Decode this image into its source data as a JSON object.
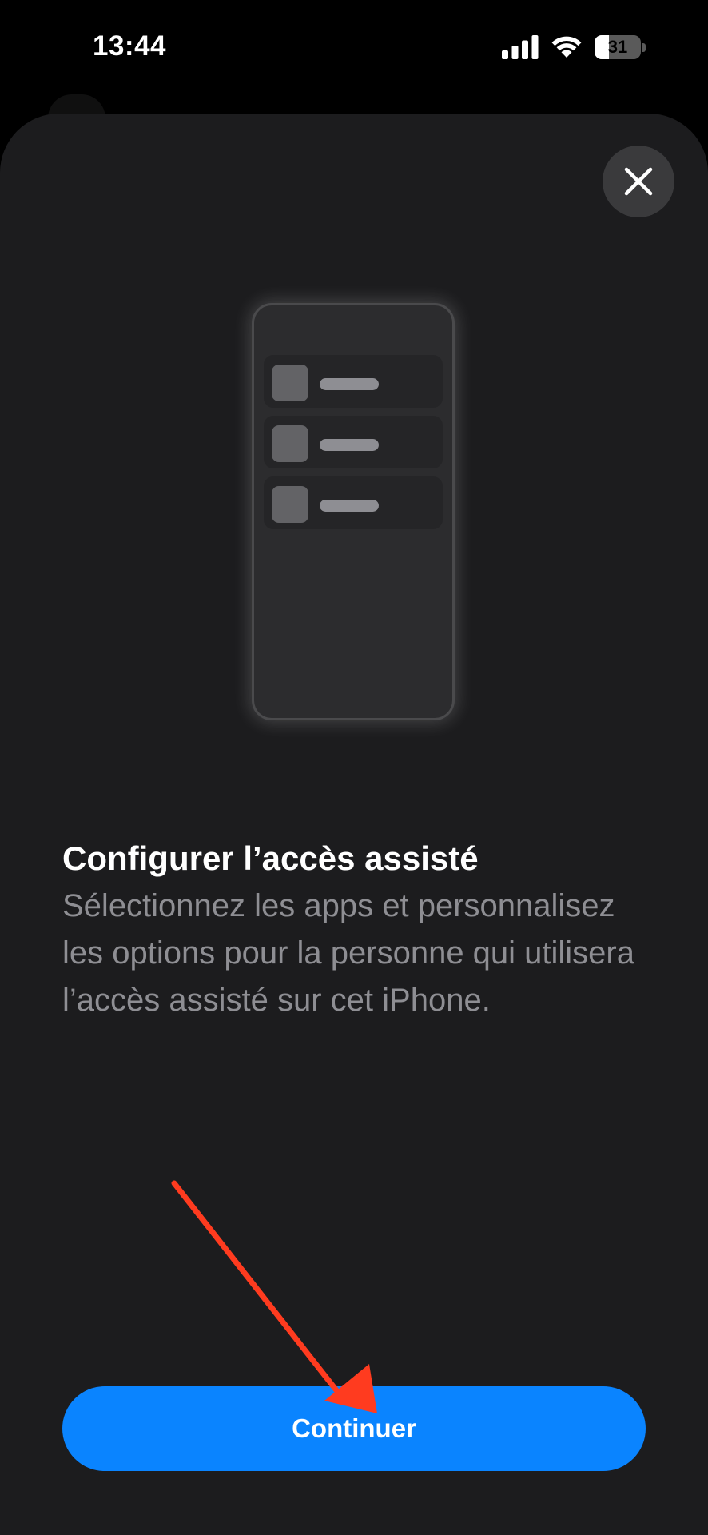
{
  "status_bar": {
    "time": "13:44",
    "battery_level": "31",
    "battery_fraction": 0.31,
    "signal_icon": "cellular-signal-icon",
    "wifi_icon": "wifi-icon",
    "battery_icon": "battery-icon"
  },
  "sheet": {
    "close_icon": "close-icon",
    "title": "Configurer l’accès assisté",
    "description": "Sélectionnez les apps et personnalisez les options pour la personne qui utilisera l’accès assisté sur cet iPhone.",
    "continue_label": "Continuer"
  },
  "illustration": {
    "rows": 3
  },
  "colors": {
    "background": "#000000",
    "sheet": "#1c1c1e",
    "accent": "#0a84ff",
    "secondary_text": "#8e8e93",
    "annotation_arrow": "#ff3b1f"
  }
}
